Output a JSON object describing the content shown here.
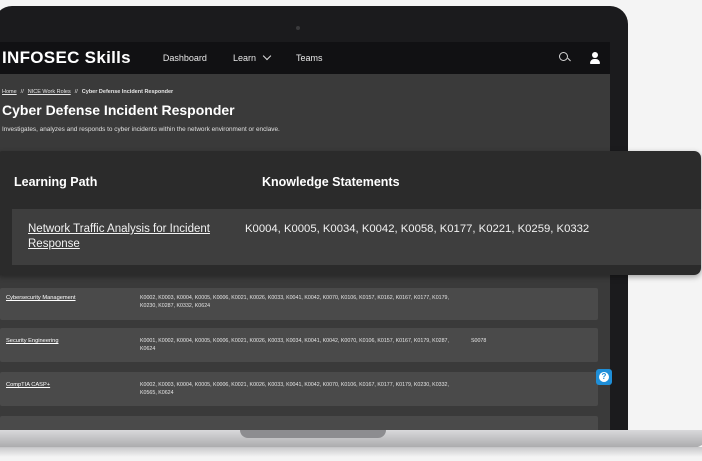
{
  "header": {
    "logo": "INFOSEC Skills",
    "nav": [
      {
        "label": "Dashboard"
      },
      {
        "label": "Learn"
      },
      {
        "label": "Teams"
      }
    ]
  },
  "breadcrumb": {
    "home": "Home",
    "sep": "//",
    "parent": "NICE Work Roles",
    "current": "Cyber Defense Incident Responder"
  },
  "page": {
    "title": "Cyber Defense Incident Responder",
    "description": "Investigates, analyzes and responds to cyber incidents within the network environment or enclave."
  },
  "zoom_card": {
    "col_learning_path": "Learning Path",
    "col_knowledge": "Knowledge Statements",
    "row": {
      "path": "Network Traffic Analysis for Incident Response",
      "knowledge": "K0004, K0005, K0034, K0042, K0058, K0177, K0221, K0259, K0332"
    }
  },
  "rows": [
    {
      "path": "Cybersecurity Management",
      "knowledge": "K0002, K0003, K0004, K0005, K0006, K0021, K0026, K0033, K0041, K0042, K0070, K0106, K0157, K0162, K0167, K0177, K0179, K0230, K0287, K0332, K0624",
      "skills": ""
    },
    {
      "path": "Security Engineering",
      "knowledge": "K0001, K0002, K0004, K0005, K0006, K0021, K0026, K0033, K0034, K0041, K0042, K0070, K0106, K0157, K0167, K0179, K0287, K0624",
      "skills": "S0078"
    },
    {
      "path": "CompTIA CASP+",
      "knowledge": "K0002, K0003, K0004, K0005, K0006, K0021, K0026, K0033, K0041, K0042, K0070, K0106, K0167, K0177, K0179, K0230, K0332, K0565, K0624",
      "skills": ""
    }
  ],
  "help": {
    "glyph": "?"
  }
}
